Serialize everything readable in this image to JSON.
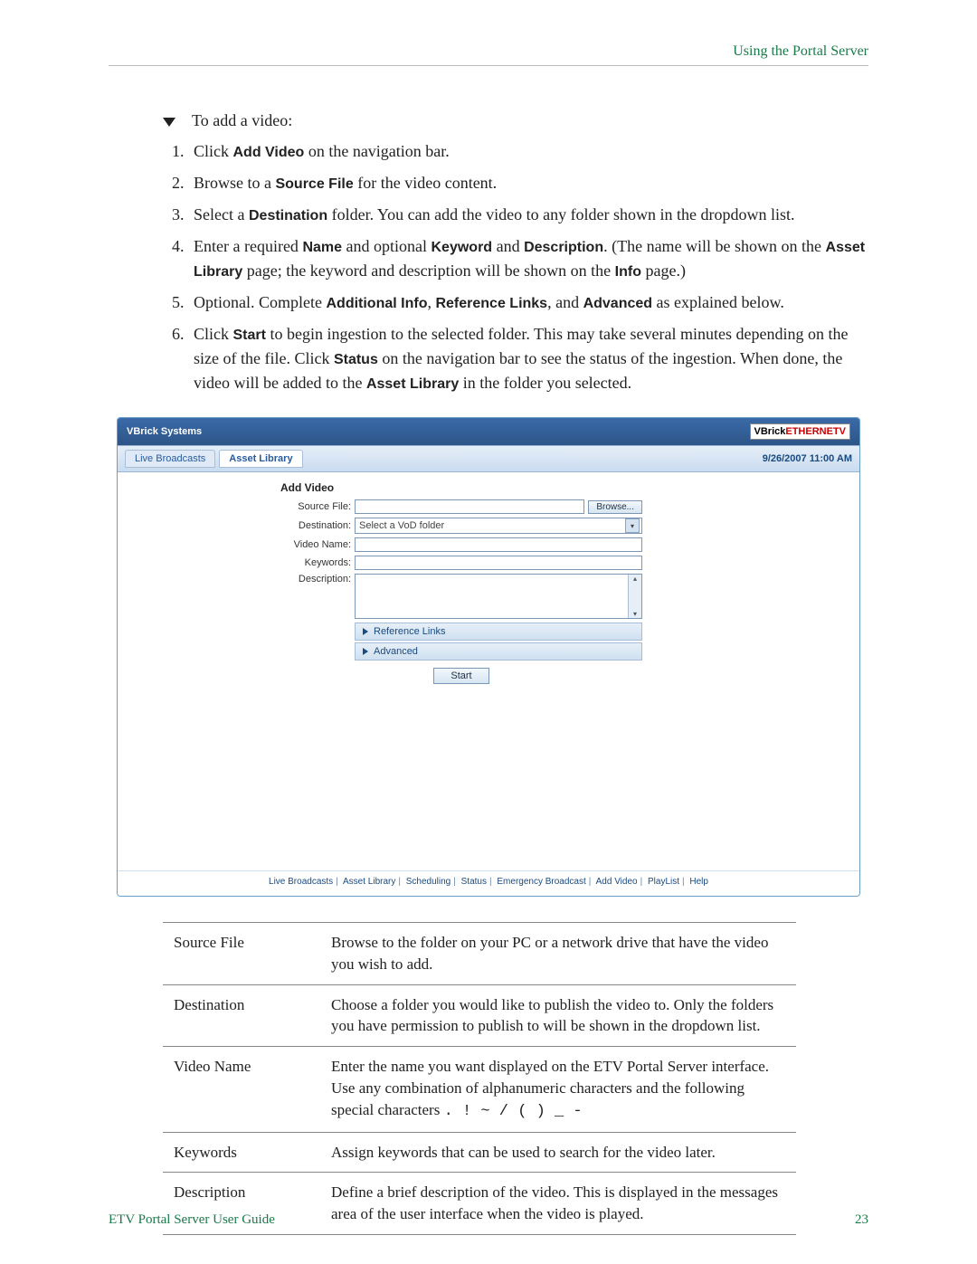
{
  "header": {
    "section_link": "Using the Portal Server"
  },
  "intro": {
    "text": "To add a video:"
  },
  "steps": {
    "s1a": "Click ",
    "s1b": "Add Video",
    "s1c": " on the navigation bar.",
    "s2a": "Browse to a ",
    "s2b": "Source File",
    "s2c": " for the video content.",
    "s3a": "Select a ",
    "s3b": "Destination",
    "s3c": " folder. You can add the video to any folder shown in the dropdown list.",
    "s4a": "Enter a required ",
    "s4b": "Name",
    "s4c": " and optional ",
    "s4d": "Keyword",
    "s4e": " and ",
    "s4f": "Description",
    "s4g": ". (The name will be shown on the ",
    "s4h": "Asset Library",
    "s4i": " page; the keyword and description will be shown on the ",
    "s4j": "Info",
    "s4k": " page.)",
    "s5a": "Optional. Complete ",
    "s5b": "Additional Info",
    "s5c": ", ",
    "s5d": "Reference Links",
    "s5e": ", and ",
    "s5f": "Advanced",
    "s5g": " as explained below.",
    "s6a": "Click ",
    "s6b": "Start",
    "s6c": " to begin ingestion to the selected folder. This may take several minutes depending on the size of the file. Click ",
    "s6d": "Status",
    "s6e": " on the navigation bar to see the status of the ingestion. When done, the video will be added to the ",
    "s6f": "Asset Library",
    "s6g": " in the folder you selected."
  },
  "screenshot": {
    "brand": "VBrick Systems",
    "logo1": "VBrick",
    "logo2": "ETHERNETV",
    "tabs": {
      "live": "Live Broadcasts",
      "asset": "Asset Library"
    },
    "timestamp": "9/26/2007 11:00 AM",
    "form": {
      "heading": "Add Video",
      "labels": {
        "source": "Source File:",
        "dest": "Destination:",
        "name": "Video Name:",
        "keywords": "Keywords:",
        "desc": "Description:"
      },
      "dest_placeholder": "Select a VoD folder",
      "browse": "Browse...",
      "ref_links": "Reference Links",
      "advanced": "Advanced",
      "start": "Start"
    },
    "footer_links": [
      "Live Broadcasts",
      "Asset Library",
      "Scheduling",
      "Status",
      "Emergency Broadcast",
      "Add Video",
      "PlayList",
      "Help"
    ]
  },
  "table": {
    "r1t": "Source File",
    "r1d": "Browse to the folder on your PC or a network drive that have the video you wish to add.",
    "r2t": "Destination",
    "r2d": "Choose a folder you would like to publish the video to. Only the folders you have permission to publish to will be shown in the dropdown list.",
    "r3t": "Video Name",
    "r3d_a": "Enter the name you want displayed on the ETV Portal Server interface. Use any combination of alphanumeric characters and the following special characters ",
    "r3d_b": ". ! ~ / ( ) _ -",
    "r4t": "Keywords",
    "r4d": "Assign keywords that can be used to search for the video later.",
    "r5t": "Description",
    "r5d": "Define a brief description of the video. This is displayed in the messages area of the user interface when the video is played."
  },
  "footer": {
    "guide": "ETV Portal Server User Guide",
    "page": "23"
  }
}
